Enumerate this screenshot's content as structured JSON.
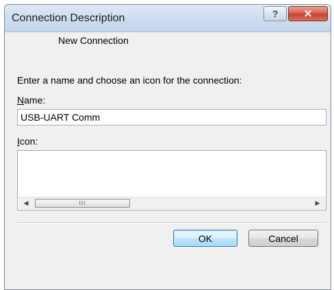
{
  "window": {
    "title": "Connection Description",
    "help_glyph": "?",
    "close_glyph": "✕"
  },
  "main": {
    "connection_label": "New Connection",
    "prompt": "Enter a name and choose an icon for the connection:",
    "name_label_accel": "N",
    "name_label_rest": "ame:",
    "name_value": "USB-UART Comm",
    "icon_label_accel": "I",
    "icon_label_rest": "con:",
    "scroll_grip": "III"
  },
  "buttons": {
    "ok_label": "OK",
    "cancel_label": "Cancel"
  },
  "icons": {
    "help": "help-icon",
    "close": "close-icon",
    "scroll_left": "chevron-left-icon",
    "scroll_right": "chevron-right-icon"
  }
}
